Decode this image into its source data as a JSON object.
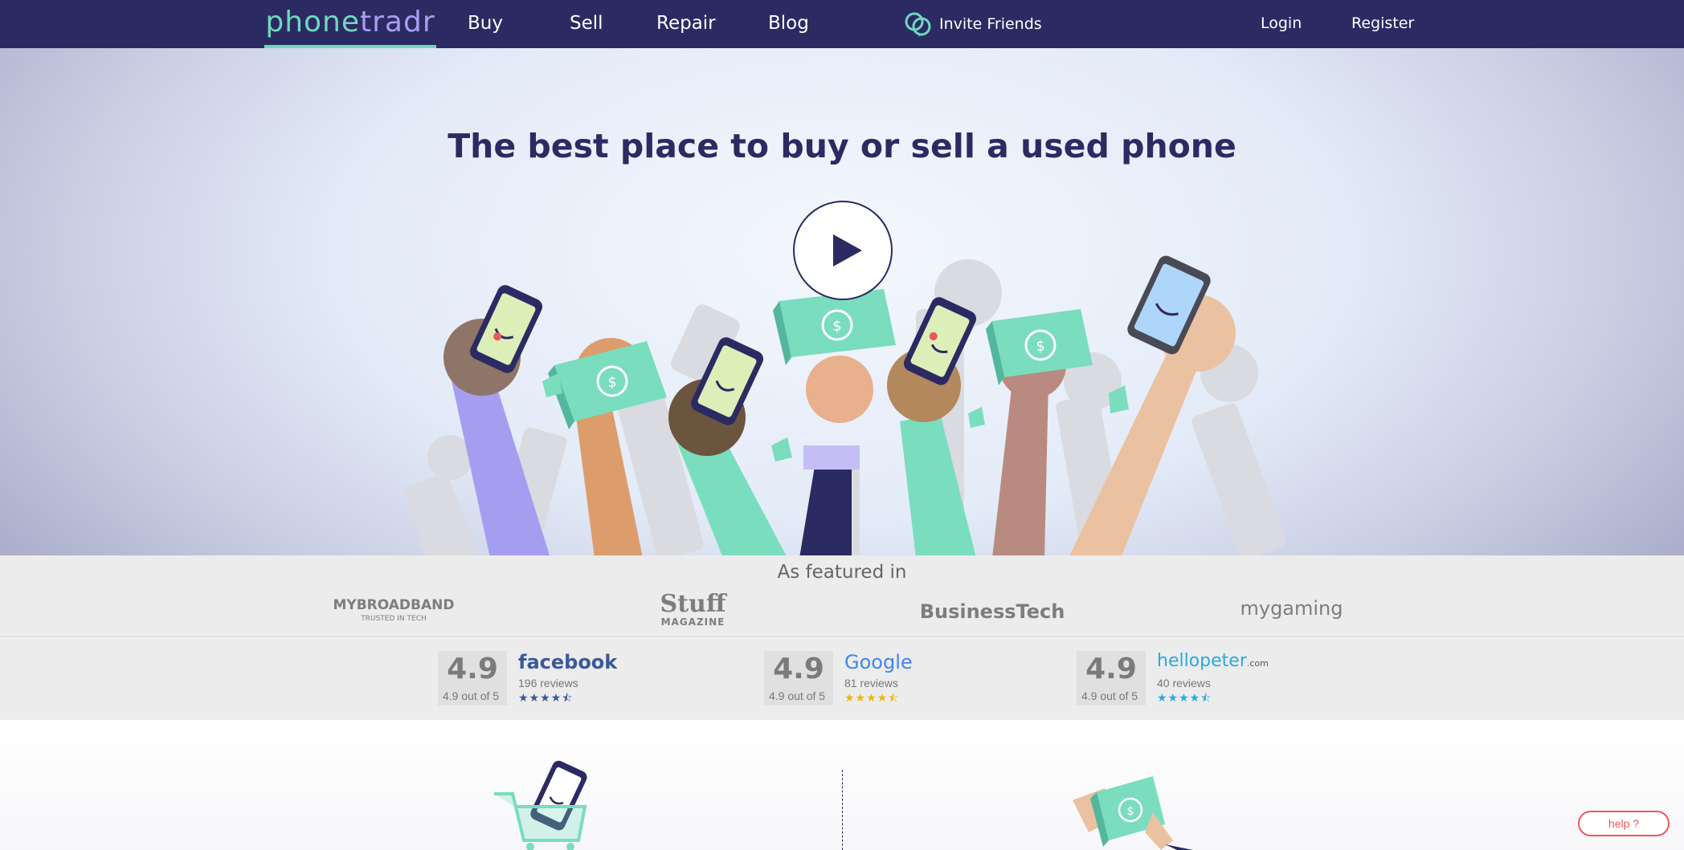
{
  "nav": {
    "logo_part1": "phone",
    "logo_part2": "tradr",
    "links": [
      "Buy",
      "Sell",
      "Repair",
      "Blog"
    ],
    "invite_label": "Invite Friends",
    "login_label": "Login",
    "register_label": "Register",
    "invite_icon": "chat-bubbles-icon"
  },
  "hero": {
    "title": "The best place to buy or sell a used phone",
    "play_icon": "play-icon"
  },
  "featured": {
    "title": "As featured in",
    "press": [
      {
        "name": "MYBROADBAND",
        "tagline": "TRUSTED IN TECH"
      },
      {
        "name": "Stuff",
        "tagline": "MAGAZINE"
      },
      {
        "name": "BusinessTech",
        "tagline": ""
      },
      {
        "name": "mygaming",
        "tagline": ""
      }
    ]
  },
  "reviews": [
    {
      "score": "4.9",
      "out_of": "4.9 out of 5",
      "brand": "facebook",
      "count": "196 reviews",
      "star_color": "#3b5998"
    },
    {
      "score": "4.9",
      "out_of": "4.9 out of 5",
      "brand": "Google",
      "count": "81 reviews",
      "star_color": "#f4b400"
    },
    {
      "score": "4.9",
      "out_of": "4.9 out of 5",
      "brand": "hellopeter",
      "brand_suffix": ".com",
      "count": "40 reviews",
      "star_color": "#29a9e1"
    }
  ],
  "help": {
    "label": "help ?"
  },
  "colors": {
    "navy": "#2c2a62",
    "mint": "#6fd8bf",
    "lavender": "#a99df0",
    "help_red": "#e85a5a"
  }
}
